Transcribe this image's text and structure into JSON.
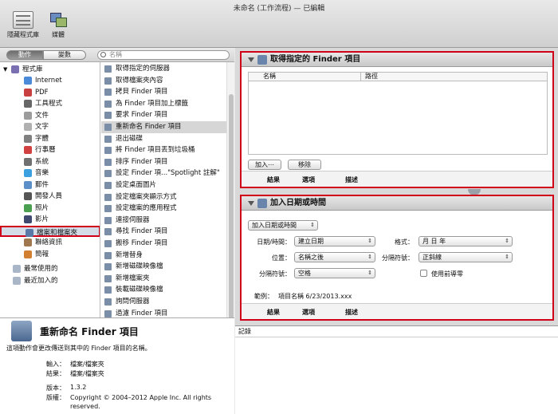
{
  "window": {
    "title": "未命名 (工作流程) — 已編輯"
  },
  "toolbar": {
    "hide_library_label": "隱藏程式庫",
    "media_label": "媒體"
  },
  "leftbar": {
    "actions_tab": "動作",
    "variables_tab": "變數",
    "search_placeholder": "名稱"
  },
  "library": {
    "root": "程式庫",
    "items": [
      {
        "label": "Internet",
        "icon": "globe-icon",
        "color": "#4a8ad8"
      },
      {
        "label": "PDF",
        "icon": "pdf-icon",
        "color": "#c94040"
      },
      {
        "label": "工具程式",
        "icon": "tools-icon",
        "color": "#666666"
      },
      {
        "label": "文件",
        "icon": "document-icon",
        "color": "#9c9c9c"
      },
      {
        "label": "文字",
        "icon": "text-icon",
        "color": "#b0b0b0"
      },
      {
        "label": "字體",
        "icon": "font-icon",
        "color": "#808080"
      },
      {
        "label": "行事曆",
        "icon": "calendar-icon",
        "color": "#d04040"
      },
      {
        "label": "系統",
        "icon": "system-icon",
        "color": "#707070"
      },
      {
        "label": "音樂",
        "icon": "music-icon",
        "color": "#3aa0e0"
      },
      {
        "label": "郵件",
        "icon": "mail-icon",
        "color": "#5a8fc8"
      },
      {
        "label": "開發人員",
        "icon": "developer-icon",
        "color": "#555555"
      },
      {
        "label": "照片",
        "icon": "photo-icon",
        "color": "#4aa050"
      },
      {
        "label": "影片",
        "icon": "movie-icon",
        "color": "#404a70"
      },
      {
        "label": "檔案和檔案夾",
        "icon": "finder-icon",
        "color": "#5a78a8"
      },
      {
        "label": "聯絡資訊",
        "icon": "contacts-icon",
        "color": "#a07850"
      },
      {
        "label": "簡報",
        "icon": "presentation-icon",
        "color": "#d08030"
      }
    ],
    "folders": [
      {
        "label": "最常使用的",
        "icon": "folder-icon"
      },
      {
        "label": "最近加入的",
        "icon": "folder-icon"
      }
    ]
  },
  "actions": [
    "取得指定的伺服器",
    "取得檔案夾內容",
    "拷貝 Finder 項目",
    "為 Finder 項目加上標籤",
    "要求 Finder 項目",
    "重新命名 Finder 項目",
    "退出磁碟",
    "將 Finder 項目丟到垃圾桶",
    "排序 Finder 項目",
    "設定 Finder 項...\"Spotlight 註解\"",
    "設定桌面圖片",
    "設定檔案夾顯示方式",
    "設定檔案的應用程式",
    "連接伺服器",
    "尋找 Finder 項目",
    "搬移 Finder 項目",
    "新增替身",
    "新增磁碟映像檔",
    "新增檔案夾",
    "裝載磁碟映像檔",
    "詢問伺服器",
    "過濾 Finder 項目"
  ],
  "description": {
    "title": "重新命名 Finder 項目",
    "text": "這項動作會更改傳送到其中的 Finder 項目的名稱。",
    "input_label": "輸入：",
    "input_value": "檔案/檔案夾",
    "result_label": "結果：",
    "result_value": "檔案/檔案夾",
    "version_label": "版本：",
    "version_value": "1.3.2",
    "copyright_label": "版權：",
    "copyright_value": "Copyright © 2004–2012 Apple Inc.  All rights reserved."
  },
  "action1": {
    "title": "取得指定的 Finder 項目",
    "col_name": "名稱",
    "col_path": "路徑",
    "add_button": "加入⋯",
    "remove_button": "移除",
    "foot": {
      "results": "結果",
      "options": "選項",
      "description": "描述"
    }
  },
  "action2": {
    "title": "加入日期或時間",
    "mode_select": "加入日期或時間",
    "date_time_label": "日期/時間：",
    "date_time_value": "建立日期",
    "format_label": "格式：",
    "format_value": "月 日 年",
    "position_label": "位置：",
    "position_value": "名稱之後",
    "separator_label": "分隔符號：",
    "separator_value": "正斜線",
    "separator2_label": "分隔符號：",
    "separator2_value": "空格",
    "leading_zero_label": "使用前導零",
    "example_label": "範例：",
    "example_value": "項目名稱 6/23/2013.xxx",
    "foot": {
      "results": "結果",
      "options": "選項",
      "description": "描述"
    }
  },
  "log": {
    "label": "記錄"
  }
}
